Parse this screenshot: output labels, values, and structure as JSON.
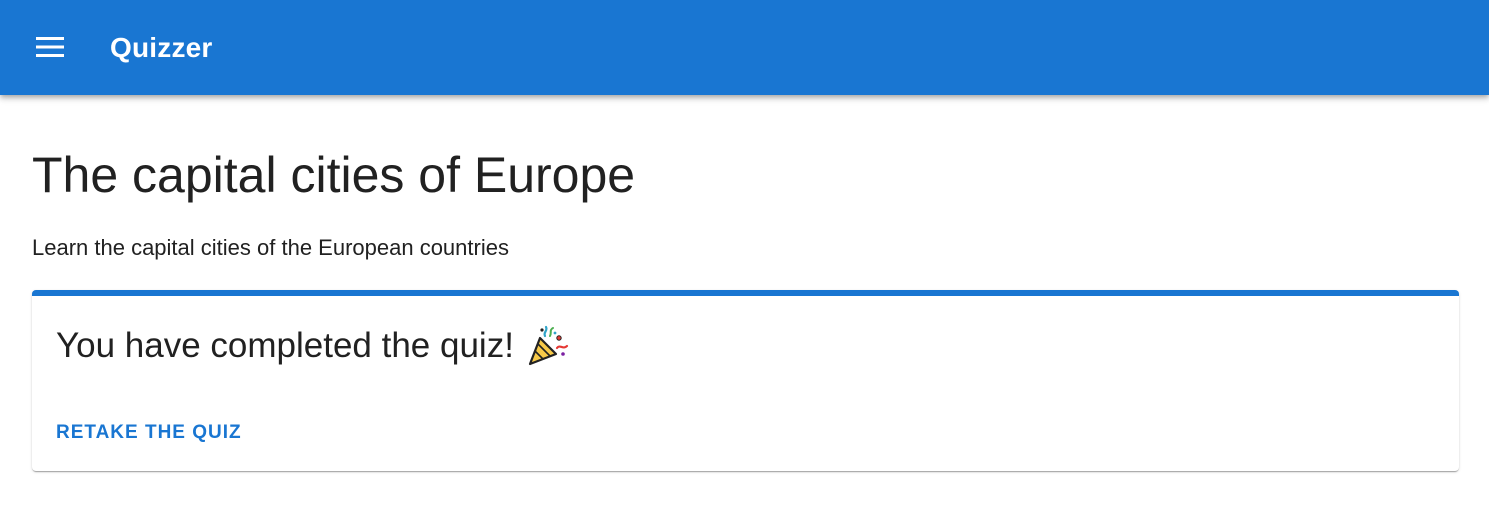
{
  "appbar": {
    "menu_icon": "menu-icon",
    "title": "Quizzer",
    "color": "#1976d2"
  },
  "page": {
    "title": "The capital cities of Europe",
    "subtitle": "Learn the capital cities of the European countries"
  },
  "result_card": {
    "message": "You have completed the quiz!",
    "emoji": "party-popper-icon",
    "retake_label": "RETAKE THE QUIZ",
    "accent_color": "#1976d2"
  }
}
